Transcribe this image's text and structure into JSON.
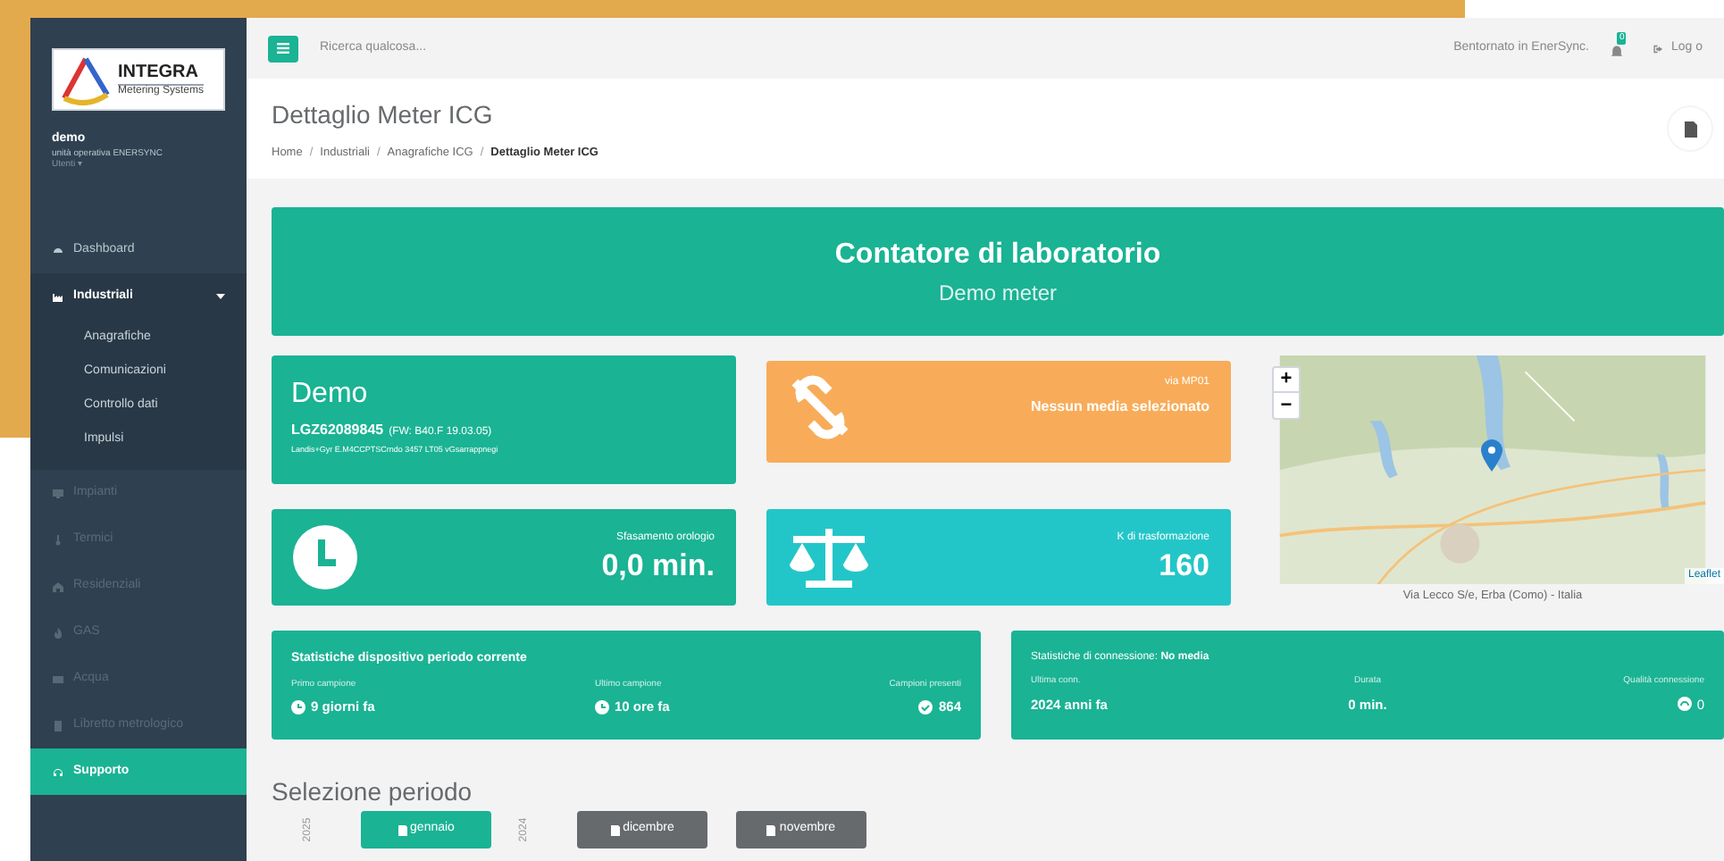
{
  "sidebar": {
    "logo": {
      "name": "INTEGRA",
      "tagline": "Metering Systems"
    },
    "user": {
      "name": "demo",
      "unit": "unità operativa ENERSYNC",
      "role": "Utenti ▾"
    },
    "items": [
      {
        "label": "Dashboard",
        "selected": false,
        "disabled": false,
        "expanded": false
      },
      {
        "label": "Industriali",
        "selected": false,
        "disabled": false,
        "expanded": true,
        "children": [
          {
            "label": "Anagrafiche"
          },
          {
            "label": "Comunicazioni"
          },
          {
            "label": "Controllo dati"
          },
          {
            "label": "Impulsi"
          }
        ]
      },
      {
        "label": "Impianti",
        "selected": false,
        "disabled": true,
        "expanded": false
      },
      {
        "label": "Termici",
        "selected": false,
        "disabled": true,
        "expanded": false
      },
      {
        "label": "Residenziali",
        "selected": false,
        "disabled": true,
        "expanded": false
      },
      {
        "label": "GAS",
        "selected": false,
        "disabled": true,
        "expanded": false
      },
      {
        "label": "Acqua",
        "selected": false,
        "disabled": true,
        "expanded": false
      },
      {
        "label": "Libretto metrologico",
        "selected": false,
        "disabled": true,
        "expanded": false
      },
      {
        "label": "Supporto",
        "selected": true,
        "disabled": false,
        "expanded": false
      }
    ]
  },
  "topbar": {
    "search": {
      "placeholder": "Ricerca qualcosa..."
    },
    "welcome": "Bentornato in EnerSync.",
    "notifications": "0",
    "logout": "Log o"
  },
  "header": {
    "title": "Dettaglio Meter ICG",
    "breadcrumbs": [
      {
        "label": "Home",
        "separator": "/"
      },
      {
        "label": "Industriali",
        "separator": "/"
      },
      {
        "label": "Anagrafiche ICG",
        "separator": "/"
      },
      {
        "label": "Dettaglio Meter ICG"
      }
    ]
  },
  "banner": {
    "title": "Contatore di laboratorio",
    "subtitle": "Demo meter"
  },
  "device": {
    "name": "Demo",
    "serial": "LGZ62089845",
    "firmware": "(FW: B40.F 19.03.05)",
    "model": "Landis+Gyr E.M4CCPTSCrndo 3457 LT05 vGsarrappnegi"
  },
  "media": {
    "label": "via MP01",
    "value": "Nessun media selezionato"
  },
  "clock": {
    "label": "Sfasamento orologio",
    "value": "0,0 min."
  },
  "transform": {
    "label": "K di trasformazione",
    "value": "160"
  },
  "map": {
    "kind": "picture",
    "attribution": "Leaflet",
    "zoom_in": "+",
    "zoom_out": "−",
    "address": "Via Lecco S/e, Erba (Como) - Italia"
  },
  "device_stats": {
    "title": "Statistiche dispositivo periodo corrente",
    "fields": [
      {
        "label": "Primo campione",
        "value": "9 giorni fa",
        "kind": "clock"
      },
      {
        "label": "Ultimo campione",
        "value": "10 ore fa",
        "kind": "clock"
      },
      {
        "label": "Campioni presenti",
        "value": "864",
        "kind": "check"
      }
    ]
  },
  "connection_stats": {
    "title": "Statistiche di connessione: **No media**",
    "fields": [
      {
        "label": "Ultima conn.",
        "value": "2024 anni fa",
        "kind": "plain"
      },
      {
        "label": "Durata",
        "value": "0 min.",
        "kind": "plain"
      },
      {
        "label": "Qualità connessione",
        "value": "0",
        "kind": "gauge"
      }
    ]
  },
  "period": {
    "title": "Selezione periodo",
    "years": [
      {
        "year": "2025",
        "months": [
          {
            "label": "gennaio",
            "selected": true
          }
        ]
      },
      {
        "year": "2024",
        "months": [
          {
            "label": "dicembre",
            "selected": false
          },
          {
            "label": "novembre",
            "selected": false
          }
        ]
      }
    ]
  }
}
